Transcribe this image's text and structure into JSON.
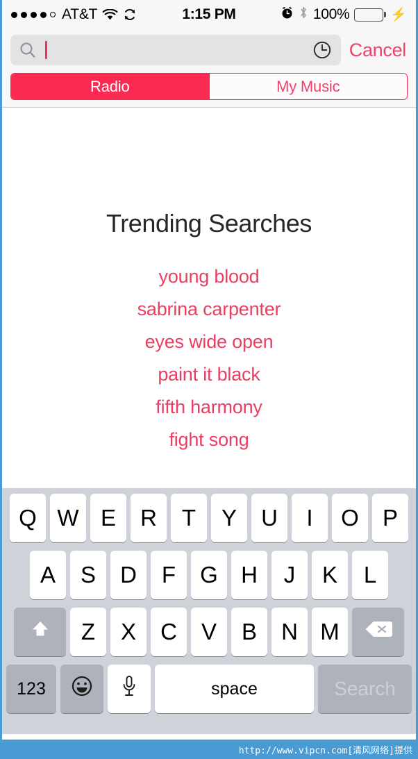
{
  "status_bar": {
    "signal_dots_filled": 4,
    "signal_dots_total": 5,
    "carrier": "AT&T",
    "wifi_icon": "wifi-icon",
    "sync_icon": "sync-icon",
    "time": "1:15 PM",
    "alarm_icon": "alarm-clock-icon",
    "bluetooth_icon": "bluetooth-icon",
    "battery_percent": "100%",
    "battery_fill_color": "#4cd964",
    "charging_icon": "lightning-bolt-icon"
  },
  "search": {
    "search_icon": "magnifier-icon",
    "value": "",
    "placeholder": "",
    "history_icon": "clock-history-icon",
    "cancel_label": "Cancel",
    "accent_color": "#f0416a",
    "cursor_color": "#f0315b"
  },
  "segmented_control": {
    "selected_index": 0,
    "active_color": "#fa2a52",
    "segments": [
      {
        "label": "Radio"
      },
      {
        "label": "My Music"
      }
    ]
  },
  "main": {
    "title": "Trending Searches",
    "title_color": "#272727",
    "item_color": "#ea3e63",
    "items": [
      {
        "label": "young blood"
      },
      {
        "label": "sabrina carpenter"
      },
      {
        "label": "eyes wide open"
      },
      {
        "label": "paint it black"
      },
      {
        "label": "fifth harmony"
      },
      {
        "label": "fight song"
      }
    ]
  },
  "keyboard": {
    "row1": [
      "Q",
      "W",
      "E",
      "R",
      "T",
      "Y",
      "U",
      "I",
      "O",
      "P"
    ],
    "row2": [
      "A",
      "S",
      "D",
      "F",
      "G",
      "H",
      "J",
      "K",
      "L"
    ],
    "row3": [
      "Z",
      "X",
      "C",
      "V",
      "B",
      "N",
      "M"
    ],
    "shift_icon": "shift-arrow-icon",
    "delete_icon": "backspace-delete-icon",
    "numbers_label": "123",
    "emoji_icon": "smiley-emoji-icon",
    "mic_icon": "microphone-icon",
    "space_label": "space",
    "search_label": "Search",
    "search_enabled": false,
    "background_color": "#cfd3d9"
  },
  "watermark": {
    "text": "http://www.vipcn.com[清风网络]提供",
    "background_color": "#4a9ad4"
  }
}
